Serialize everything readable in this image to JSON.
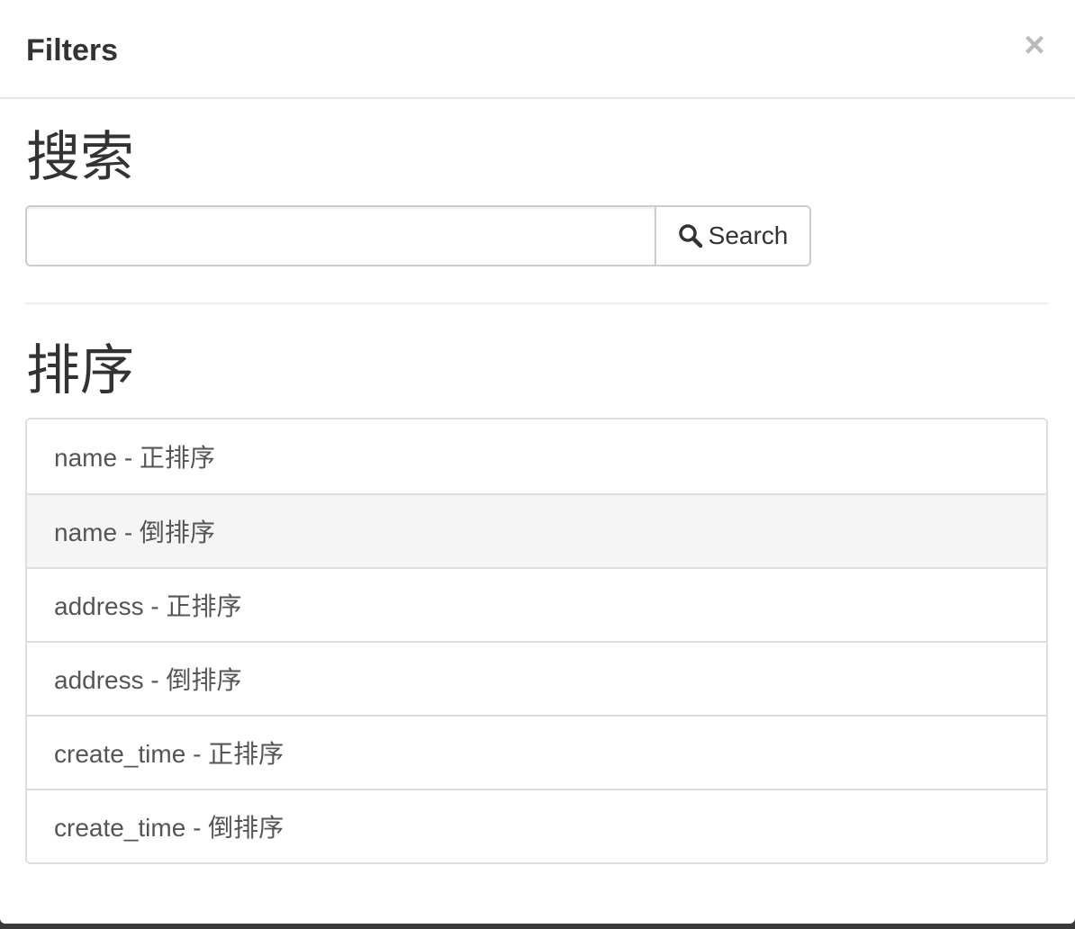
{
  "header": {
    "title": "Filters",
    "close_label": "×"
  },
  "search": {
    "heading": "搜索",
    "input_value": "",
    "placeholder": "",
    "button_label": "Search",
    "button_icon": "search-icon"
  },
  "sort": {
    "heading": "排序",
    "items": [
      {
        "label": "name - 正排序",
        "highlighted": false
      },
      {
        "label": "name - 倒排序",
        "highlighted": true
      },
      {
        "label": "address - 正排序",
        "highlighted": false
      },
      {
        "label": "address - 倒排序",
        "highlighted": false
      },
      {
        "label": "create_time - 正排序",
        "highlighted": false
      },
      {
        "label": "create_time - 倒排序",
        "highlighted": false
      }
    ]
  },
  "colors": {
    "text": "#333333",
    "muted_text": "#555555",
    "border": "#dddddd",
    "highlight_bg": "#f5f5f5",
    "close_icon": "#bbbbbb"
  }
}
